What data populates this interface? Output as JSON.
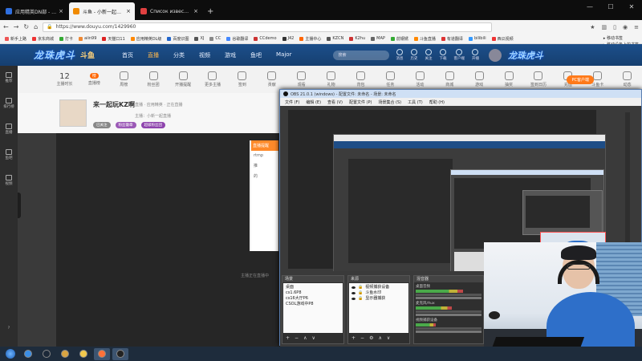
{
  "browser": {
    "tabs": [
      {
        "label": "应用精英DN部 - 百度搜索 - 轻松",
        "color": "#2f6fe0",
        "active": false
      },
      {
        "label": "斗鱼 - 小新一起直播_应用精英",
        "color": "#f08a00",
        "active": true
      },
      {
        "label": "Список известных мне карт",
        "color": "#e04040",
        "active": false
      }
    ],
    "new_tab": "+",
    "url": "https://www.douyu.com/1429960",
    "window_controls": [
      "—",
      "☐",
      "✕"
    ],
    "bookmarks": [
      {
        "label": "新手上路",
        "color": "#e55"
      },
      {
        "label": "京东商城",
        "color": "#e33"
      },
      {
        "label": "打卡",
        "color": "#3a3"
      },
      {
        "label": "aiin99",
        "color": "#e83"
      },
      {
        "label": "天猫口11",
        "color": "#d22"
      },
      {
        "label": "应用精英DL级",
        "color": "#f80"
      },
      {
        "label": "百度识图",
        "color": "#26c"
      },
      {
        "label": "XJ",
        "color": "#555"
      },
      {
        "label": "CC",
        "color": "#888"
      },
      {
        "label": "谷歌翻译",
        "color": "#48f"
      },
      {
        "label": "CCdemo",
        "color": "#c33"
      },
      {
        "label": "J42",
        "color": "#333"
      },
      {
        "label": "主播中心",
        "color": "#f60"
      },
      {
        "label": "KZCN",
        "color": "#555"
      },
      {
        "label": "K2hu",
        "color": "#c33"
      },
      {
        "label": "MAP",
        "color": "#666"
      },
      {
        "label": "前钢锈",
        "color": "#3a3"
      },
      {
        "label": "斗鱼直播",
        "color": "#f80"
      },
      {
        "label": "有道翻译",
        "color": "#d33"
      },
      {
        "label": "bilibili",
        "color": "#39f"
      },
      {
        "label": "西瓜视频",
        "color": "#e33"
      }
    ],
    "bookmarks_right": [
      "移动书签",
      "移动设备上的书签"
    ]
  },
  "site": {
    "logo": "龙珠虎斗",
    "logo_mark": "斗鱼",
    "nav": [
      "首页",
      "直播",
      "分类",
      "视频",
      "游戏",
      "鱼吧",
      "Major"
    ],
    "nav_active_index": 1,
    "search_placeholder": "搜索",
    "header_icons": [
      "消息",
      "历史",
      "关注",
      "下载",
      "客户端",
      "开播"
    ],
    "brand_right": "龙珠虎斗"
  },
  "left_sidebar": [
    "推荐",
    "排行榜",
    "直播",
    "鱼吧",
    "视频"
  ],
  "left_sidebar_bottom": "?",
  "category_bar": {
    "count": "12",
    "items": [
      "主播时长",
      "直播榜",
      "周榜",
      "粉丝团",
      "开播提醒",
      "更多主播",
      "签到",
      "贡献",
      "观看",
      "礼物",
      "背包",
      "任务",
      "活动",
      "商城",
      "游戏",
      "抽奖",
      "签到日历",
      "充值",
      "斗鱼卡",
      "动态"
    ],
    "badge": "榜",
    "pc_button": "PC客户端"
  },
  "anchor": {
    "name": "来一起玩KZ啊",
    "meta": "直播 · 应用精英 · 正在直播",
    "sub": "主播：小新一起直播",
    "tags": [
      {
        "label": "已关注",
        "color": "#888"
      },
      {
        "label": "粉丝徽章",
        "color": "#9b59b6"
      },
      {
        "label": "超级粉丝团",
        "color": "#8e44ad"
      }
    ]
  },
  "popup": {
    "header": "直播提醒",
    "lines": [
      "rtmp",
      "推",
      "的"
    ]
  },
  "chat_note": "主播正在直播中",
  "obs": {
    "title": "OBS 21.0.1 (windows) - 配置文件: 未命名 - 场景: 未命名",
    "menu": [
      "文件 (F)",
      "编辑 (E)",
      "查看 (V)",
      "配置文件 (P)",
      "场景集合 (S)",
      "工具 (T)",
      "帮助 (H)"
    ],
    "docks": {
      "scenes": {
        "title": "场景",
        "items": [
          "桌面",
          "cs1.6P8",
          "cs16大厅P6",
          "CSOL游戏中P8"
        ]
      },
      "sources": {
        "title": "来源",
        "items": [
          "视频捕获设备",
          "斗鱼水印",
          "显示器捕获"
        ]
      },
      "mixer": {
        "title": "混音器",
        "channels": [
          {
            "name": "桌面音频",
            "level": 0.72
          },
          {
            "name": "麦克风/Aux",
            "level": 0.55
          },
          {
            "name": "视频捕获设备",
            "level": 0.3
          }
        ]
      },
      "tool_glyphs": [
        "+",
        "−",
        "⚙",
        "∧",
        "∨"
      ]
    }
  },
  "taskbar": {
    "apps": [
      {
        "name": "start",
        "color": "#1b5db5"
      },
      {
        "name": "ie",
        "color": "#3a8ee6"
      },
      {
        "name": "steam",
        "color": "#1b2838"
      },
      {
        "name": "cs",
        "color": "#d9a441"
      },
      {
        "name": "explorer",
        "color": "#f2c94c"
      },
      {
        "name": "firefox",
        "color": "#ff7139"
      },
      {
        "name": "obs",
        "color": "#222222"
      }
    ]
  }
}
